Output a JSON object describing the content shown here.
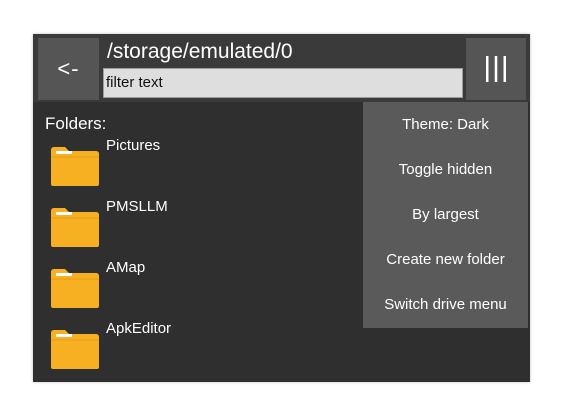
{
  "header": {
    "back_label": "<-",
    "path": "/storage/emulated/0",
    "filter_placeholder": "filter text",
    "menu_glyph": "|||"
  },
  "folders": {
    "heading": "Folders:",
    "items": [
      {
        "name": "Pictures"
      },
      {
        "name": "PMSLLM"
      },
      {
        "name": "AMap"
      },
      {
        "name": "ApkEditor"
      }
    ]
  },
  "menu": {
    "items": [
      {
        "label": "Theme: Dark"
      },
      {
        "label": "Toggle hidden"
      },
      {
        "label": "By largest"
      },
      {
        "label": "Create new folder"
      },
      {
        "label": "Switch drive menu"
      }
    ]
  },
  "colors": {
    "background": "#2f2f2f",
    "button": "#555555",
    "menu": "#5a5a5a",
    "folder": "#f7b021",
    "folder_tab": "#ffffff"
  },
  "icons": {
    "folder": "folder-icon",
    "menu": "hamburger-icon"
  }
}
